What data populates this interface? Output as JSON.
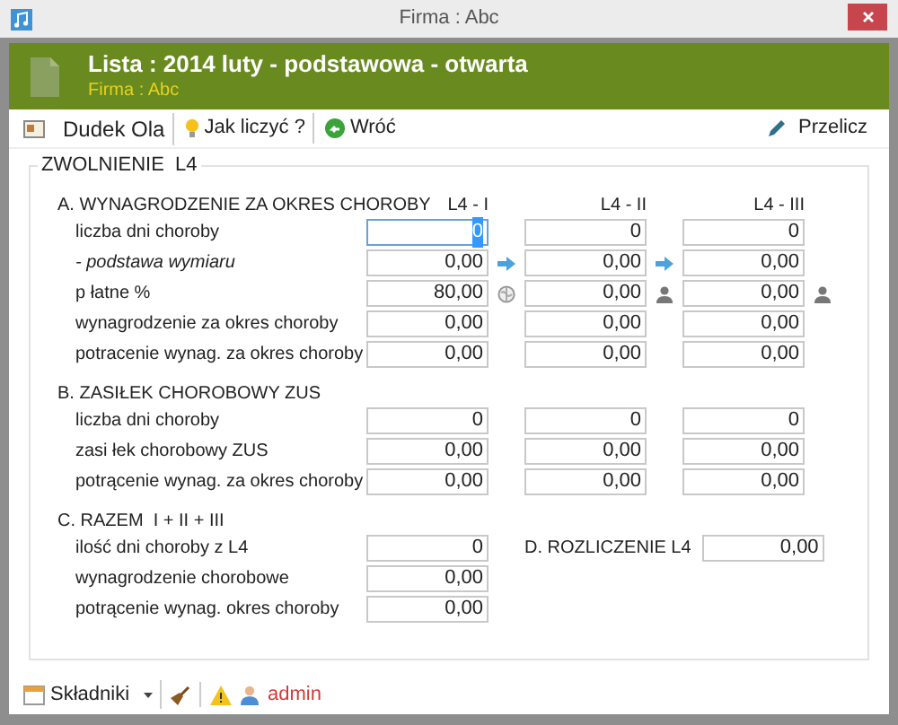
{
  "window": {
    "title": "Firma : Abc"
  },
  "header": {
    "title": "Lista : 2014 luty - podstawowa - otwarta",
    "subtitle": "Firma : Abc"
  },
  "toolbar": {
    "employee": "Dudek Ola",
    "help": "Jak liczyć ?",
    "back": "Wróć",
    "recalc": "Przelicz"
  },
  "group": {
    "title": "ZWOLNIENIE  L4",
    "columns": [
      "L4 - I",
      "L4 - II",
      "L4 - III"
    ],
    "sections": [
      {
        "title": "A. WYNAGRODZENIE ZA OKRES CHOROBY",
        "rows": [
          {
            "label": "liczba dni choroby",
            "italic": false,
            "cells": [
              {
                "value": "0",
                "focused": true
              },
              {
                "value": "0",
                "focused": false
              },
              {
                "value": "0",
                "focused": false
              }
            ]
          },
          {
            "label": "- podstawa wymiaru",
            "italic": true,
            "cells": [
              {
                "value": "0,00",
                "focused": false,
                "marker": {
                  "kind": "arrow"
                }
              },
              {
                "value": "0,00",
                "focused": false,
                "marker": {
                  "kind": "arrow"
                }
              },
              {
                "value": "0,00",
                "focused": false
              }
            ]
          },
          {
            "label": "p łatne %",
            "italic": false,
            "cells": [
              {
                "value": "80,00",
                "focused": false,
                "marker": {
                  "kind": "globe"
                }
              },
              {
                "value": "0,00",
                "focused": false,
                "marker": {
                  "kind": "person"
                }
              },
              {
                "value": "0,00",
                "focused": false,
                "marker": {
                  "kind": "person"
                }
              }
            ]
          },
          {
            "label": "wynagrodzenie za okres choroby",
            "italic": false,
            "cells": [
              {
                "value": "0,00",
                "focused": false
              },
              {
                "value": "0,00",
                "focused": false
              },
              {
                "value": "0,00",
                "focused": false
              }
            ]
          },
          {
            "label": "potracenie wynag. za okres choroby",
            "italic": false,
            "cells": [
              {
                "value": "0,00",
                "focused": false
              },
              {
                "value": "0,00",
                "focused": false
              },
              {
                "value": "0,00",
                "focused": false
              }
            ]
          }
        ]
      },
      {
        "title": "B. ZASIŁEK CHOROBOWY ZUS",
        "rows": [
          {
            "label": "liczba dni choroby",
            "italic": false,
            "cells": [
              {
                "value": "0",
                "focused": false
              },
              {
                "value": "0",
                "focused": false
              },
              {
                "value": "0",
                "focused": false
              }
            ]
          },
          {
            "label": "zasi łek chorobowy ZUS",
            "italic": false,
            "cells": [
              {
                "value": "0,00",
                "focused": false
              },
              {
                "value": "0,00",
                "focused": false
              },
              {
                "value": "0,00",
                "focused": false
              }
            ]
          },
          {
            "label": "potrącenie wynag. za okres choroby",
            "italic": false,
            "cells": [
              {
                "value": "0,00",
                "focused": false
              },
              {
                "value": "0,00",
                "focused": false
              },
              {
                "value": "0,00",
                "focused": false
              }
            ]
          }
        ]
      },
      {
        "title": "C. RAZEM  I + II + III",
        "rows": [
          {
            "label": "ilość dni choroby z L4",
            "italic": false,
            "cells": [
              {
                "value": "0",
                "focused": false
              }
            ],
            "extra": {
              "label": "D. ROZLICZENIE L4",
              "value": "0,00"
            }
          },
          {
            "label": "wynagrodzenie chorobowe",
            "italic": false,
            "cells": [
              {
                "value": "0,00",
                "focused": false
              }
            ]
          },
          {
            "label": "potrącenie wynag. okres choroby",
            "italic": false,
            "cells": [
              {
                "value": "0,00",
                "focused": false
              }
            ]
          }
        ]
      }
    ]
  },
  "bottom_bar": {
    "components": "Składniki",
    "user": "admin"
  }
}
